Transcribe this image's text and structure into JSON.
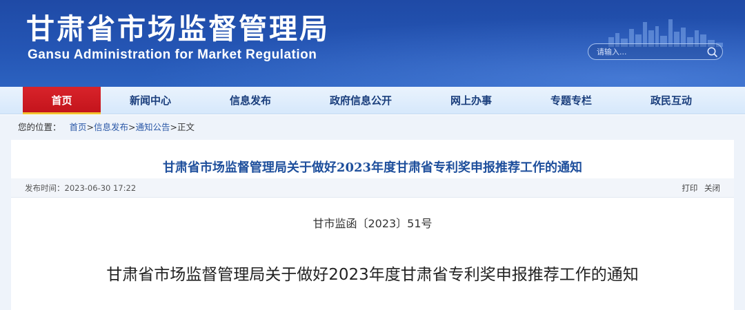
{
  "header": {
    "title": "甘肃省市场监督管理局",
    "subtitle": "Gansu Administration for Market Regulation",
    "search_placeholder": "请输入..."
  },
  "nav": {
    "items": [
      {
        "label": "首页",
        "active": true
      },
      {
        "label": "新闻中心"
      },
      {
        "label": "信息发布"
      },
      {
        "label": "政府信息公开"
      },
      {
        "label": "网上办事"
      },
      {
        "label": "专题专栏"
      },
      {
        "label": "政民互动"
      }
    ]
  },
  "breadcrumb": {
    "prefix": "您的位置：",
    "items": [
      "首页",
      ">",
      "信息发布",
      ">",
      "通知公告",
      ">",
      "正文"
    ]
  },
  "article": {
    "heading": "甘肃省市场监督管理局关于做好2023年度甘肃省专利奖申报推荐工作的通知",
    "publish_time_label": "发布时间：",
    "publish_time": "2023-06-30 17:22",
    "actions": [
      "打印",
      "关闭"
    ],
    "doc_number": "甘市监函〔2023〕51号",
    "doc_title": "甘肃省市场监督管理局关于做好2023年度甘肃省专利奖申报推荐工作的通知"
  },
  "colors": {
    "header_blue": "#2455b4",
    "nav_active_red": "#d8232a",
    "nav_text": "#1a3e7c",
    "heading_blue": "#1e4f9c"
  }
}
